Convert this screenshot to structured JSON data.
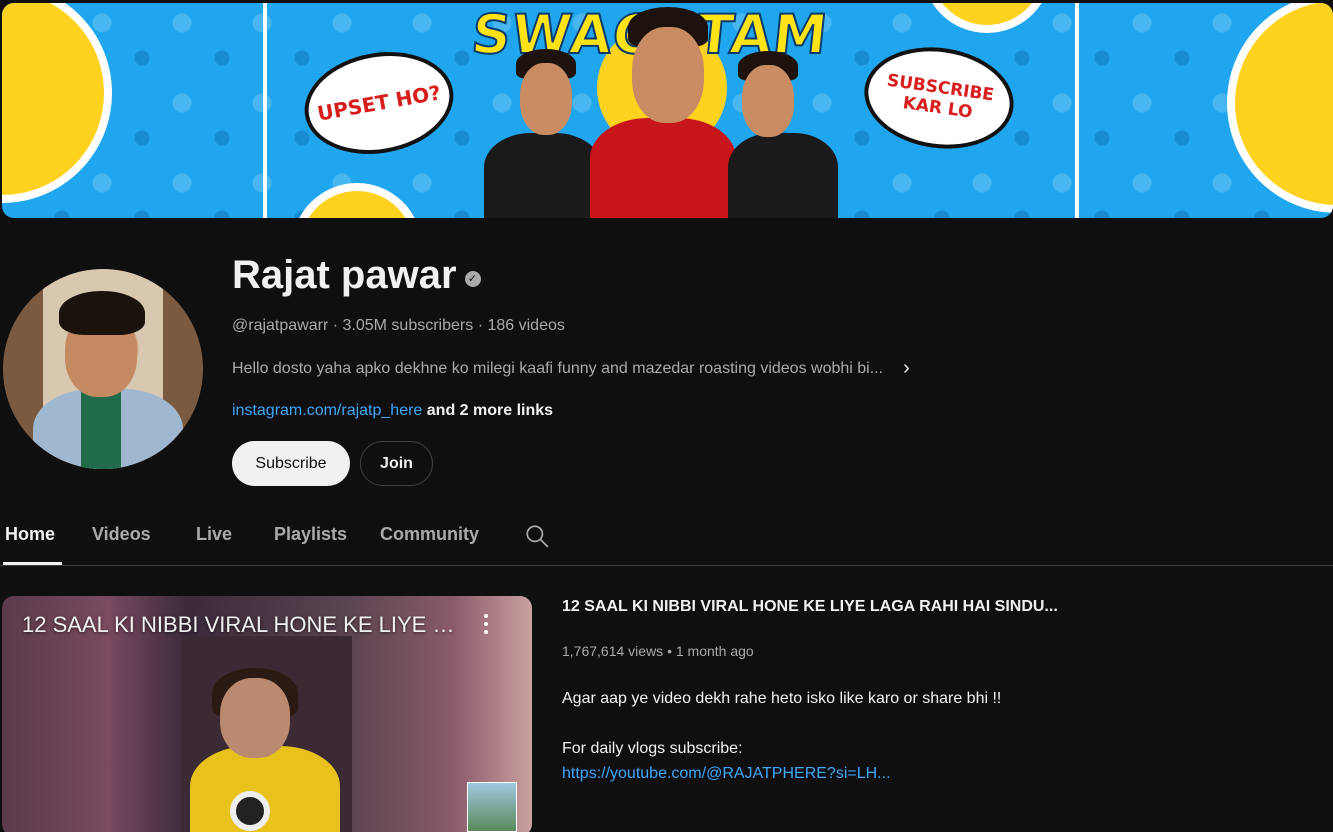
{
  "banner": {
    "title": "SWAGATAM",
    "bubble_left": "UPSET HO?",
    "bubble_right_line1": "SUBSCRIBE",
    "bubble_right_line2": "KAR LO"
  },
  "channel": {
    "name": "Rajat pawar",
    "handle": "@rajatpawarr",
    "subscribers": "3.05M subscribers",
    "videos": "186 videos",
    "description": "Hello dosto yaha apko dekhne ko milegi kaafi funny and mazedar roasting videos wobhi bi...",
    "link": "instagram.com/rajatp_here",
    "more_links": "and 2 more links",
    "subscribe_label": "Subscribe",
    "join_label": "Join"
  },
  "tabs": [
    {
      "label": "Home",
      "active": true
    },
    {
      "label": "Videos"
    },
    {
      "label": "Live"
    },
    {
      "label": "Playlists"
    },
    {
      "label": "Community"
    }
  ],
  "featured": {
    "thumb_title": "12 SAAL KI NIBBI VIRAL HONE KE LIYE L...",
    "title": "12 SAAL KI NIBBI VIRAL HONE KE LIYE LAGA RAHI HAI SINDU...",
    "views": "1,767,614 views",
    "age": "1 month ago",
    "desc_line1": "Agar aap ye video dekh rahe heto isko like karo or share bhi !!",
    "desc_line2": "For daily vlogs subscribe:",
    "desc_url": "https://youtube.com/@RAJATPHERE?si=LH..."
  }
}
